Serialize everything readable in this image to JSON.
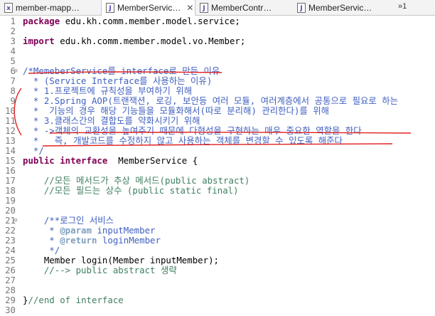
{
  "tabs": [
    {
      "label": "member-mapp…",
      "icon": "xml-file-icon"
    },
    {
      "label": "MemberServic…",
      "icon": "java-file-icon",
      "active": true,
      "close": "✕"
    },
    {
      "label": "MemberContr…",
      "icon": "java-file-icon"
    },
    {
      "label": "MemberServic…",
      "icon": "java-file-icon"
    }
  ],
  "overflow_count": "»1",
  "lines": [
    {
      "n": "1",
      "parts": [
        [
          "kw",
          "package"
        ],
        [
          "",
          "edu.kh.comm.member.model.service;"
        ]
      ]
    },
    {
      "n": "2",
      "parts": []
    },
    {
      "n": "3",
      "parts": [
        [
          "kw",
          "import"
        ],
        [
          "",
          "edu.kh.comm.member.model.vo.Member;"
        ]
      ]
    },
    {
      "n": "4",
      "parts": []
    },
    {
      "n": "5",
      "parts": []
    },
    {
      "n": "6",
      "fold": "⊖",
      "parts": [
        [
          "jd",
          "/*MemeberService를 interface로 만든 이유"
        ]
      ]
    },
    {
      "n": "7",
      "parts": [
        [
          "jd",
          "  * (Service Interface를 사용하는 이유)"
        ]
      ]
    },
    {
      "n": "8",
      "parts": [
        [
          "jd",
          "  * 1.프로젝트에 규칙성을 부여하기 위해"
        ]
      ]
    },
    {
      "n": "9",
      "parts": [
        [
          "jd",
          "  * 2.Spring AOP(트랜잭션, 로깅, 보안등 여러 모듈, 여러계층에서 공통으로 필요로 하는"
        ]
      ]
    },
    {
      "n": "10",
      "parts": [
        [
          "jd",
          "  *  기능의 경우 해당 기능들을 모듈화해서(따로 분리해) 관리한다)를 위해"
        ]
      ]
    },
    {
      "n": "11",
      "parts": [
        [
          "jd",
          "  * 3.클래스간의 결합도를 약화시키기 위해"
        ]
      ]
    },
    {
      "n": "12",
      "parts": [
        [
          "jd",
          "  * ->객체의 교환성을 높여주기 때문에 다형성을 구현하는 매우 중요한 역할을 한다"
        ]
      ]
    },
    {
      "n": "13",
      "parts": [
        [
          "jd",
          "  *   즉, 개발코드를 수정하지 않고 사용하는 객체를 변경할 수 있도록 해준다"
        ]
      ]
    },
    {
      "n": "14",
      "parts": [
        [
          "jd",
          "  */"
        ]
      ]
    },
    {
      "n": "15",
      "parts": [
        [
          "kw",
          "public interface"
        ],
        [
          "",
          " MemberService {"
        ]
      ]
    },
    {
      "n": "16",
      "parts": []
    },
    {
      "n": "17",
      "parts": [
        [
          "cm",
          "    //모든 메서드가 추상 메서드(public abstract)"
        ]
      ]
    },
    {
      "n": "18",
      "parts": [
        [
          "cm",
          "    //모든 필드는 상수 (public static final)"
        ]
      ]
    },
    {
      "n": "19",
      "parts": []
    },
    {
      "n": "20",
      "parts": []
    },
    {
      "n": "21",
      "fold": "⊖",
      "parts": [
        [
          "jd",
          "    /**로그인 서비스"
        ]
      ]
    },
    {
      "n": "22",
      "parts": [
        [
          "jd",
          "     * "
        ],
        [
          "tag",
          "@param"
        ],
        [
          "jd",
          " inputMember"
        ]
      ]
    },
    {
      "n": "23",
      "parts": [
        [
          "jd",
          "     * "
        ],
        [
          "tag",
          "@return"
        ],
        [
          "jd",
          " loginMember"
        ]
      ]
    },
    {
      "n": "24",
      "parts": [
        [
          "jd",
          "     */"
        ]
      ]
    },
    {
      "n": "25",
      "parts": [
        [
          "",
          "    Member login(Member inputMember);"
        ]
      ]
    },
    {
      "n": "26",
      "parts": [
        [
          "cm",
          "    //--> public abstract 생략"
        ]
      ]
    },
    {
      "n": "27",
      "parts": []
    },
    {
      "n": "28",
      "parts": []
    },
    {
      "n": "29",
      "parts": [
        [
          "",
          "}"
        ],
        [
          "cm",
          "//end of interface"
        ]
      ]
    },
    {
      "n": "30",
      "parts": []
    }
  ],
  "colors": {
    "keyword": "#7f0055",
    "comment": "#3f7f5f",
    "javadoc": "#3f5fbf",
    "annotation_pen": "#e02020"
  }
}
